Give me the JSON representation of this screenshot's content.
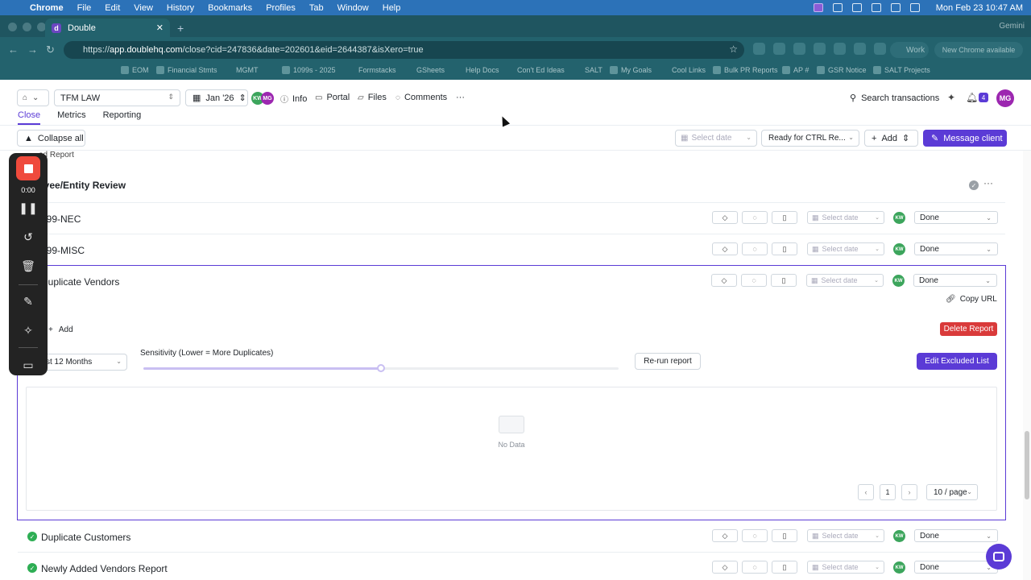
{
  "menubar": {
    "app": "Chrome",
    "items": [
      "File",
      "Edit",
      "View",
      "History",
      "Bookmarks",
      "Profiles",
      "Tab",
      "Window",
      "Help"
    ],
    "clock": "Mon Feb 23  10:47 AM"
  },
  "browser": {
    "tab_title": "Double",
    "tab_favicon": "d",
    "url_prefix": "https://",
    "url_host": "app.doublehq.com",
    "url_path": "/close?cid=247836&date=202601&eid=2644387&isXero=true",
    "work_chip": "Work",
    "new_chrome": "New Chrome available",
    "gemini": "Gemini"
  },
  "bookmarks": [
    "EOM",
    "Financial Stmts",
    "MGMT",
    "1099s - 2025",
    "Formstacks",
    "GSheets",
    "Help Docs",
    "Con't Ed Ideas",
    "SALT",
    "My Goals",
    "Cool Links",
    "Bulk PR Reports",
    "AP #",
    "GSR Notice",
    "SALT Projects"
  ],
  "header": {
    "client": "TFM LAW",
    "period": "Jan '26",
    "avatars": [
      "KW",
      "MG"
    ],
    "links": [
      "Info",
      "Portal",
      "Files",
      "Comments"
    ],
    "search": "Search transactions",
    "notif_count": "4",
    "me": "MG",
    "subtabs": [
      "Close",
      "Metrics",
      "Reporting"
    ]
  },
  "toolbar": {
    "collapse": "Collapse all",
    "select_date": "Select date",
    "status": "Ready for CTRL Re...",
    "add": "Add",
    "message": "Message client"
  },
  "content": {
    "cut_top": "ad Report",
    "section_title": "ayee/Entity Review",
    "rows": [
      {
        "title": "099-NEC",
        "date": "Select date",
        "assignee": "KW",
        "status": "Done"
      },
      {
        "title": "099-MISC",
        "date": "Select date",
        "assignee": "KW",
        "status": "Done"
      },
      {
        "title": "Duplicate Vendors",
        "date": "Select date",
        "assignee": "KW",
        "status": "Done"
      }
    ],
    "expanded": {
      "copy_url": "Copy URL",
      "add": "Add",
      "delete": "Delete Report",
      "period": "st 12 Months",
      "sensitivity_label": "Sensitivity (Lower = More Duplicates)",
      "sensitivity_value": 0.5,
      "rerun": "Re-run report",
      "edit_excluded": "Edit Excluded List",
      "no_data": "No Data",
      "page": "1",
      "page_size": "10 / page"
    },
    "rows_after": [
      {
        "title": "Duplicate Customers",
        "date": "Select date",
        "assignee": "KW",
        "status": "Done"
      },
      {
        "title": "Newly Added Vendors Report",
        "date": "Select date",
        "assignee": "KW",
        "status": "Done"
      }
    ]
  },
  "recorder": {
    "time": "0:00"
  }
}
